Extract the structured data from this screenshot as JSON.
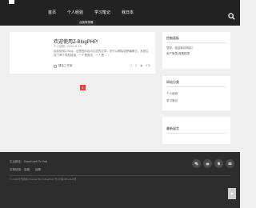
{
  "header": {
    "nav": [
      "首页",
      "个人经验",
      "学习笔记",
      "我日本"
    ],
    "tooltip": "点我有惊喜"
  },
  "post": {
    "title": "欢迎使用Z-BlogPHP!",
    "meta": "个人经验 • 2024-11-10",
    "excerpt": "欢迎使用Z-Blog，这是程序自动生成的文章，您可以删除或是编辑它。系统生成了两个导航链接，一个是首页，一个是……",
    "author": "建站工作室",
    "comments": "0",
    "views": "370"
  },
  "pagination": {
    "current": "1"
  },
  "widgets": {
    "about": {
      "title": "控制面板",
      "links": [
        "您好，欢迎到访网站！",
        "用户登录 查看权限"
      ]
    },
    "category": {
      "title": "网站分类",
      "links": [
        "个人经验",
        "学习笔记"
      ]
    },
    "latest": {
      "title": "最新留言"
    }
  },
  "footer": {
    "motto_label": "生活格言：",
    "motto": "Good Luck To You!",
    "links_label": "友情链接：",
    "links": [
      "百度",
      "谷歌"
    ],
    "copyright": "© 2018 时光随笔 Powered By Z-BlogPHP  粤ICP备18012345号"
  },
  "colors": {
    "accent": "#e0473b",
    "topbar": "#222222",
    "footer": "#2d2d2d"
  },
  "icons": [
    "search-icon",
    "wechat-icon",
    "weibo-icon",
    "qq-icon",
    "email-icon",
    "back-to-top-icon"
  ]
}
